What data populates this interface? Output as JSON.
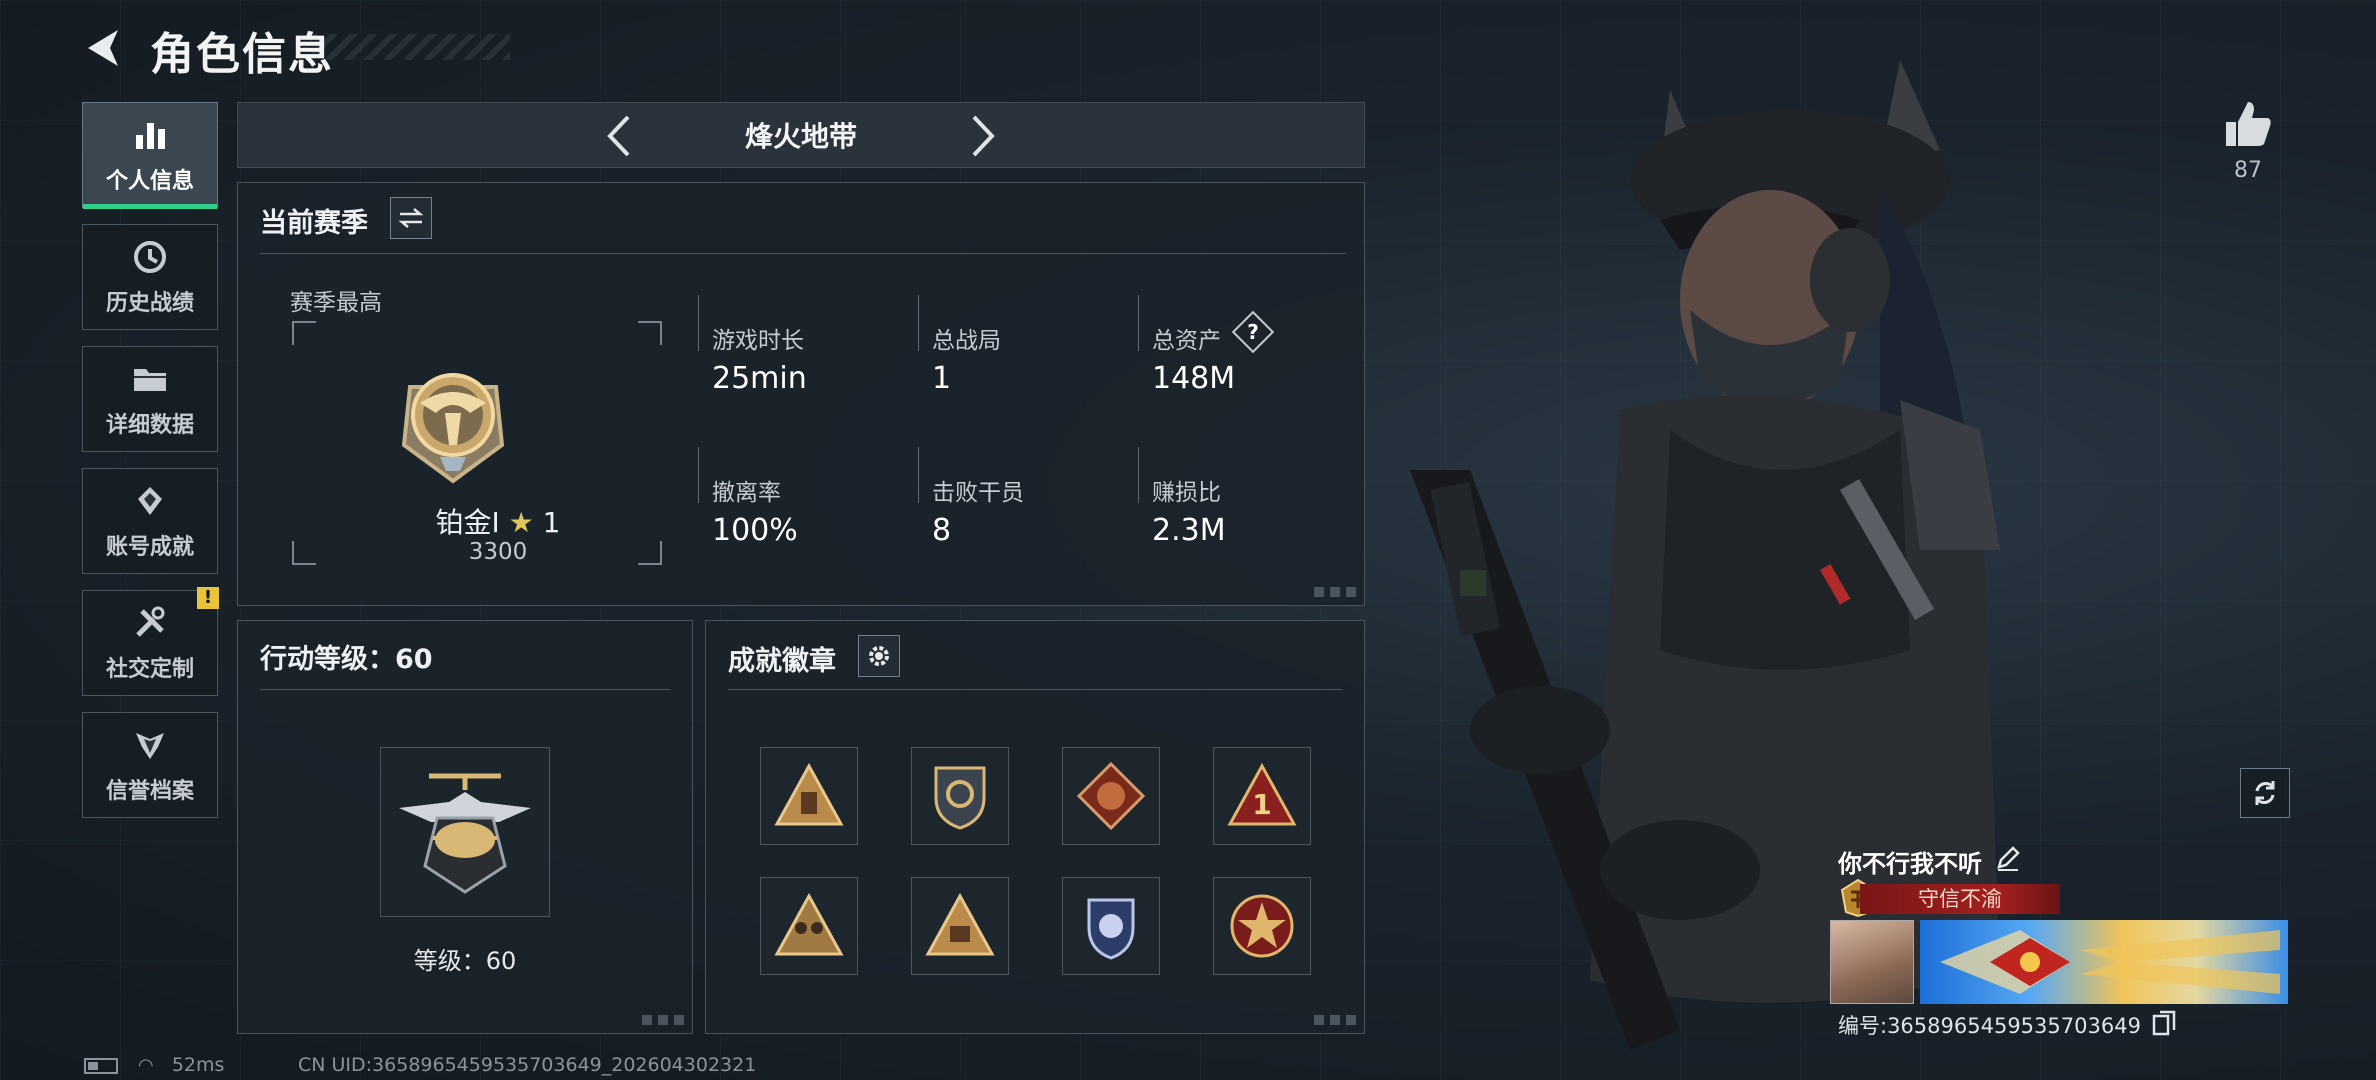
{
  "header": {
    "title": "角色信息"
  },
  "sidebar": {
    "items": [
      {
        "label": "个人信息",
        "icon": "bar-chart-icon",
        "active": true
      },
      {
        "label": "历史战绩",
        "icon": "clock-history-icon"
      },
      {
        "label": "详细数据",
        "icon": "folder-icon"
      },
      {
        "label": "账号成就",
        "icon": "diamond-medal-icon"
      },
      {
        "label": "社交定制",
        "icon": "tools-icon",
        "badge": "!"
      },
      {
        "label": "信誉档案",
        "icon": "shield-wing-icon"
      }
    ]
  },
  "mode": {
    "name": "烽火地带"
  },
  "season": {
    "title": "当前赛季",
    "best_label": "赛季最高",
    "rank_name": "铂金Ⅰ",
    "rank_stars": "1",
    "rank_points": "3300",
    "stats": [
      {
        "label": "游戏时长",
        "value": "25min"
      },
      {
        "label": "总战局",
        "value": "1"
      },
      {
        "label": "总资产",
        "value": "148M",
        "help": "?"
      },
      {
        "label": "撤离率",
        "value": "100%"
      },
      {
        "label": "击败干员",
        "value": "8"
      },
      {
        "label": "赚损比",
        "value": "2.3M"
      }
    ]
  },
  "action_level": {
    "title": "行动等级：60",
    "level_text": "等级：60"
  },
  "badges": {
    "title": "成就徽章",
    "items": [
      "triangle-badge-icon",
      "shield-target-badge-icon",
      "dragon-badge-icon",
      "number-one-badge-icon",
      "soldiers-badge-icon",
      "chest-badge-icon",
      "police-shield-badge-icon",
      "skull-star-badge-icon"
    ]
  },
  "profile": {
    "likes": "87",
    "player_name": "你不行我不听",
    "player_title": "守信不渝",
    "uid_label": "编号:3658965459535703649"
  },
  "footer": {
    "ping": "52ms",
    "uid": "CN UID:3658965459535703649_202604302321"
  },
  "colors": {
    "accent": "#2fd08c",
    "warning": "#e9c43a",
    "title_red": "#a32020"
  }
}
